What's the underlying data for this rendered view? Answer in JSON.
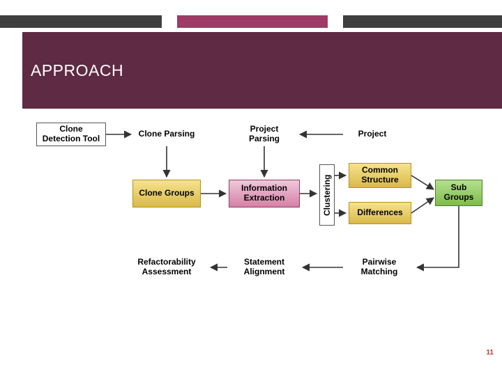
{
  "title": "APPROACH",
  "nodes": {
    "clone_detection_tool": "Clone Detection Tool",
    "clone_parsing": "Clone Parsing",
    "project_parsing": "Project Parsing",
    "project": "Project",
    "clone_groups": "Clone Groups",
    "information_extraction": "Information Extraction",
    "clustering": "Clustering",
    "common_structure": "Common Structure",
    "differences": "Differences",
    "sub_groups": "Sub Groups",
    "refactorability_assessment": "Refactorability Assessment",
    "statement_alignment": "Statement Alignment",
    "pairwise_matching": "Pairwise Matching"
  },
  "page_number": "11",
  "colors": {
    "title_band": "#5e2a44",
    "accent": "#9e3b67",
    "yellow": "#e9cf6a",
    "pink": "#e0a4bd",
    "green": "#98cd6c"
  }
}
